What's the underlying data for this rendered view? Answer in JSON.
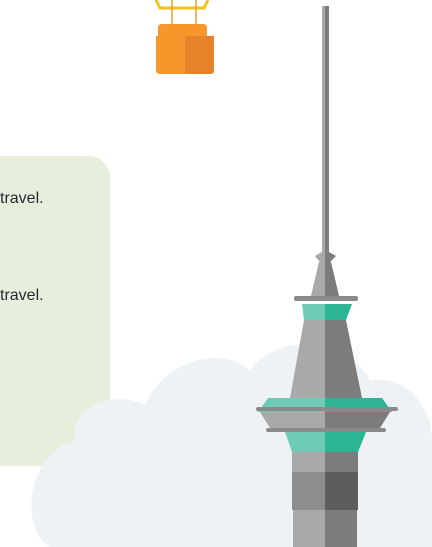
{
  "text_lines": [
    "travel.",
    "travel."
  ],
  "colors": {
    "panel": "#e7eedb",
    "cloud": "#eef2f4",
    "tower_light": "#a9a9a9",
    "tower_dark": "#7c7c7c",
    "tower_teal_light": "#6fcbb6",
    "tower_teal_dark": "#2bb595",
    "balloon_basket": "#f7962a",
    "balloon_rope": "#f5c21a"
  }
}
